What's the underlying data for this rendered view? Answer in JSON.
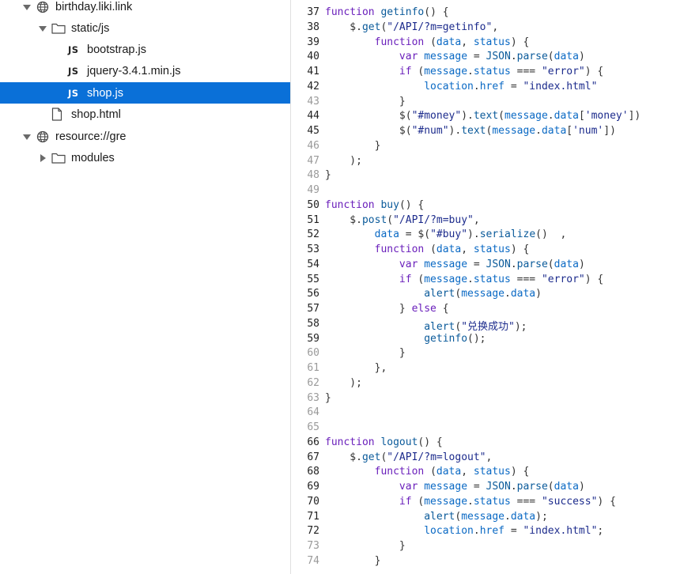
{
  "colors": {
    "selection": "#0a70d8",
    "keyword": "#6a1fbb",
    "function_name": "#0a5a9a",
    "property": "#0a69c4",
    "string": "#1c2b8c",
    "plain": "#333333",
    "line_number": "#9a9a9a"
  },
  "file_tree": [
    {
      "label": "birthday.liki.link",
      "icon": "globe-icon",
      "twisty": "expanded",
      "depth": 0
    },
    {
      "label": "static/js",
      "icon": "folder-icon",
      "twisty": "expanded",
      "depth": 1
    },
    {
      "label": "bootstrap.js",
      "icon": "js-file-icon",
      "twisty": "none",
      "depth": 2
    },
    {
      "label": "jquery-3.4.1.min.js",
      "icon": "js-file-icon",
      "twisty": "none",
      "depth": 2
    },
    {
      "label": "shop.js",
      "icon": "js-file-icon",
      "twisty": "none",
      "depth": 2,
      "selected": true
    },
    {
      "label": "shop.html",
      "icon": "file-icon",
      "twisty": "none",
      "depth": 1
    },
    {
      "label": "resource://gre",
      "icon": "globe-icon",
      "twisty": "expanded",
      "depth": 0
    },
    {
      "label": "modules",
      "icon": "folder-icon",
      "twisty": "collapsed",
      "depth": 1
    }
  ],
  "js_icon_text": "JS",
  "editor": {
    "file": "shop.js",
    "lines": [
      {
        "n": "37",
        "tokens": [
          [
            "k",
            "function "
          ],
          [
            "f",
            "getinfo"
          ],
          [
            "t",
            "() {"
          ]
        ]
      },
      {
        "n": "38",
        "tokens": [
          [
            "t",
            "    $."
          ],
          [
            "f",
            "get"
          ],
          [
            "t",
            "("
          ],
          [
            "s",
            "\"/API/?m=getinfo\""
          ],
          [
            "t",
            ","
          ]
        ]
      },
      {
        "n": "39",
        "tokens": [
          [
            "t",
            "        "
          ],
          [
            "k",
            "function "
          ],
          [
            "t",
            "("
          ],
          [
            "p",
            "data"
          ],
          [
            "t",
            ", "
          ],
          [
            "p",
            "status"
          ],
          [
            "t",
            ") {"
          ]
        ]
      },
      {
        "n": "40",
        "tokens": [
          [
            "t",
            "            "
          ],
          [
            "k",
            "var "
          ],
          [
            "p",
            "message"
          ],
          [
            "t",
            " = "
          ],
          [
            "f",
            "JSON"
          ],
          [
            "t",
            "."
          ],
          [
            "f",
            "parse"
          ],
          [
            "t",
            "("
          ],
          [
            "p",
            "data"
          ],
          [
            "t",
            ")"
          ]
        ]
      },
      {
        "n": "41",
        "tokens": [
          [
            "t",
            "            "
          ],
          [
            "k",
            "if "
          ],
          [
            "t",
            "("
          ],
          [
            "p",
            "message"
          ],
          [
            "t",
            "."
          ],
          [
            "p",
            "status"
          ],
          [
            "t",
            " === "
          ],
          [
            "s",
            "\"error\""
          ],
          [
            "t",
            ") {"
          ]
        ]
      },
      {
        "n": "42",
        "tokens": [
          [
            "t",
            "                "
          ],
          [
            "p",
            "location"
          ],
          [
            "t",
            "."
          ],
          [
            "p",
            "href"
          ],
          [
            "t",
            " = "
          ],
          [
            "s",
            "\"index.html\""
          ]
        ]
      },
      {
        "n": "43",
        "tokens": [
          [
            "t",
            "            }"
          ]
        ]
      },
      {
        "n": "44",
        "tokens": [
          [
            "t",
            "            $("
          ],
          [
            "s",
            "\"#money\""
          ],
          [
            "t",
            ")."
          ],
          [
            "f",
            "text"
          ],
          [
            "t",
            "("
          ],
          [
            "p",
            "message"
          ],
          [
            "t",
            "."
          ],
          [
            "p",
            "data"
          ],
          [
            "t",
            "["
          ],
          [
            "s",
            "'money'"
          ],
          [
            "t",
            "])"
          ]
        ]
      },
      {
        "n": "45",
        "tokens": [
          [
            "t",
            "            $("
          ],
          [
            "s",
            "\"#num\""
          ],
          [
            "t",
            ")."
          ],
          [
            "f",
            "text"
          ],
          [
            "t",
            "("
          ],
          [
            "p",
            "message"
          ],
          [
            "t",
            "."
          ],
          [
            "p",
            "data"
          ],
          [
            "t",
            "["
          ],
          [
            "s",
            "'num'"
          ],
          [
            "t",
            "])"
          ]
        ]
      },
      {
        "n": "46",
        "tokens": [
          [
            "t",
            "        }"
          ]
        ]
      },
      {
        "n": "47",
        "tokens": [
          [
            "t",
            "    );"
          ]
        ]
      },
      {
        "n": "48",
        "tokens": [
          [
            "t",
            "}"
          ]
        ]
      },
      {
        "n": "49",
        "tokens": []
      },
      {
        "n": "50",
        "tokens": [
          [
            "k",
            "function "
          ],
          [
            "f",
            "buy"
          ],
          [
            "t",
            "() {"
          ]
        ]
      },
      {
        "n": "51",
        "tokens": [
          [
            "t",
            "    $."
          ],
          [
            "f",
            "post"
          ],
          [
            "t",
            "("
          ],
          [
            "s",
            "\"/API/?m=buy\""
          ],
          [
            "t",
            ","
          ]
        ]
      },
      {
        "n": "52",
        "tokens": [
          [
            "t",
            "        "
          ],
          [
            "p",
            "data"
          ],
          [
            "t",
            " = $("
          ],
          [
            "s",
            "\"#buy\""
          ],
          [
            "t",
            ")."
          ],
          [
            "f",
            "serialize"
          ],
          [
            "t",
            "()  ,"
          ]
        ]
      },
      {
        "n": "53",
        "tokens": [
          [
            "t",
            "        "
          ],
          [
            "k",
            "function "
          ],
          [
            "t",
            "("
          ],
          [
            "p",
            "data"
          ],
          [
            "t",
            ", "
          ],
          [
            "p",
            "status"
          ],
          [
            "t",
            ") {"
          ]
        ]
      },
      {
        "n": "54",
        "tokens": [
          [
            "t",
            "            "
          ],
          [
            "k",
            "var "
          ],
          [
            "p",
            "message"
          ],
          [
            "t",
            " = "
          ],
          [
            "f",
            "JSON"
          ],
          [
            "t",
            "."
          ],
          [
            "f",
            "parse"
          ],
          [
            "t",
            "("
          ],
          [
            "p",
            "data"
          ],
          [
            "t",
            ")"
          ]
        ]
      },
      {
        "n": "55",
        "tokens": [
          [
            "t",
            "            "
          ],
          [
            "k",
            "if "
          ],
          [
            "t",
            "("
          ],
          [
            "p",
            "message"
          ],
          [
            "t",
            "."
          ],
          [
            "p",
            "status"
          ],
          [
            "t",
            " === "
          ],
          [
            "s",
            "\"error\""
          ],
          [
            "t",
            ") {"
          ]
        ]
      },
      {
        "n": "56",
        "tokens": [
          [
            "t",
            "                "
          ],
          [
            "f",
            "alert"
          ],
          [
            "t",
            "("
          ],
          [
            "p",
            "message"
          ],
          [
            "t",
            "."
          ],
          [
            "p",
            "data"
          ],
          [
            "t",
            ")"
          ]
        ]
      },
      {
        "n": "57",
        "tokens": [
          [
            "t",
            "            } "
          ],
          [
            "k",
            "else"
          ],
          [
            "t",
            " {"
          ]
        ]
      },
      {
        "n": "58",
        "tokens": [
          [
            "t",
            "                "
          ],
          [
            "f",
            "alert"
          ],
          [
            "t",
            "("
          ],
          [
            "s",
            "\"兑换成功\""
          ],
          [
            "t",
            ");"
          ]
        ]
      },
      {
        "n": "59",
        "tokens": [
          [
            "t",
            "                "
          ],
          [
            "f",
            "getinfo"
          ],
          [
            "t",
            "();"
          ]
        ]
      },
      {
        "n": "60",
        "tokens": [
          [
            "t",
            "            }"
          ]
        ]
      },
      {
        "n": "61",
        "tokens": [
          [
            "t",
            "        },"
          ]
        ]
      },
      {
        "n": "62",
        "tokens": [
          [
            "t",
            "    );"
          ]
        ]
      },
      {
        "n": "63",
        "tokens": [
          [
            "t",
            "}"
          ]
        ]
      },
      {
        "n": "64",
        "tokens": []
      },
      {
        "n": "65",
        "tokens": []
      },
      {
        "n": "66",
        "tokens": [
          [
            "k",
            "function "
          ],
          [
            "f",
            "logout"
          ],
          [
            "t",
            "() {"
          ]
        ]
      },
      {
        "n": "67",
        "tokens": [
          [
            "t",
            "    $."
          ],
          [
            "f",
            "get"
          ],
          [
            "t",
            "("
          ],
          [
            "s",
            "\"/API/?m=logout\""
          ],
          [
            "t",
            ","
          ]
        ]
      },
      {
        "n": "68",
        "tokens": [
          [
            "t",
            "        "
          ],
          [
            "k",
            "function "
          ],
          [
            "t",
            "("
          ],
          [
            "p",
            "data"
          ],
          [
            "t",
            ", "
          ],
          [
            "p",
            "status"
          ],
          [
            "t",
            ") {"
          ]
        ]
      },
      {
        "n": "69",
        "tokens": [
          [
            "t",
            "            "
          ],
          [
            "k",
            "var "
          ],
          [
            "p",
            "message"
          ],
          [
            "t",
            " = "
          ],
          [
            "f",
            "JSON"
          ],
          [
            "t",
            "."
          ],
          [
            "f",
            "parse"
          ],
          [
            "t",
            "("
          ],
          [
            "p",
            "data"
          ],
          [
            "t",
            ")"
          ]
        ]
      },
      {
        "n": "70",
        "tokens": [
          [
            "t",
            "            "
          ],
          [
            "k",
            "if "
          ],
          [
            "t",
            "("
          ],
          [
            "p",
            "message"
          ],
          [
            "t",
            "."
          ],
          [
            "p",
            "status"
          ],
          [
            "t",
            " === "
          ],
          [
            "s",
            "\"success\""
          ],
          [
            "t",
            ") {"
          ]
        ]
      },
      {
        "n": "71",
        "tokens": [
          [
            "t",
            "                "
          ],
          [
            "f",
            "alert"
          ],
          [
            "t",
            "("
          ],
          [
            "p",
            "message"
          ],
          [
            "t",
            "."
          ],
          [
            "p",
            "data"
          ],
          [
            "t",
            ");"
          ]
        ]
      },
      {
        "n": "72",
        "tokens": [
          [
            "t",
            "                "
          ],
          [
            "p",
            "location"
          ],
          [
            "t",
            "."
          ],
          [
            "p",
            "href"
          ],
          [
            "t",
            " = "
          ],
          [
            "s",
            "\"index.html\""
          ],
          [
            "t",
            ";"
          ]
        ]
      },
      {
        "n": "73",
        "tokens": [
          [
            "t",
            "            }"
          ]
        ]
      },
      {
        "n": "74",
        "tokens": [
          [
            "t",
            "        }"
          ]
        ]
      }
    ]
  }
}
